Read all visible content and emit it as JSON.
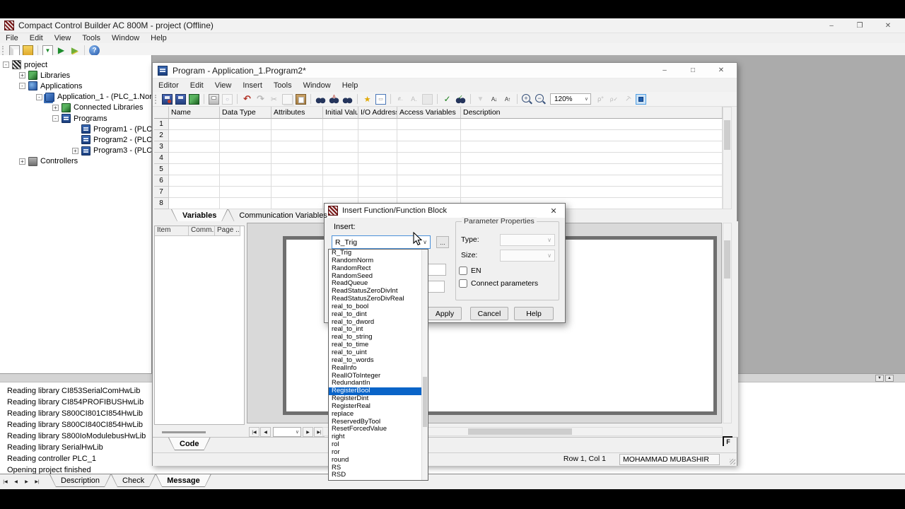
{
  "window": {
    "title": "Compact Control Builder AC 800M - project   (Offline)",
    "menu": [
      "File",
      "Edit",
      "View",
      "Tools",
      "Window",
      "Help"
    ],
    "toolbar": [
      {
        "name": "new-icon"
      },
      {
        "name": "open-icon"
      },
      {
        "sep": 1
      },
      {
        "name": "download-project-icon"
      },
      {
        "name": "go-online-icon"
      },
      {
        "name": "go-offline-icon"
      },
      {
        "sep": 1
      },
      {
        "name": "help-icon"
      }
    ],
    "controls": [
      "minimize",
      "restore",
      "close"
    ]
  },
  "tree": {
    "items": [
      {
        "label": "project",
        "depth": 0,
        "icon": "project-icon",
        "expander": "-"
      },
      {
        "label": "Libraries",
        "depth": 1,
        "icon": "libraries-icon",
        "expander": "+"
      },
      {
        "label": "Applications",
        "depth": 1,
        "icon": "applications-icon",
        "expander": "-"
      },
      {
        "label": "Application_1 - (PLC_1.Nor",
        "depth": 2,
        "icon": "application-icon",
        "expander": "-"
      },
      {
        "label": "Connected Libraries",
        "depth": 3,
        "icon": "libraries-icon",
        "expander": "+"
      },
      {
        "label": "Programs",
        "depth": 3,
        "icon": "programs-icon",
        "expander": "-"
      },
      {
        "label": "Program1 - (PLC",
        "depth": 4,
        "icon": "program-icon",
        "expander": ""
      },
      {
        "label": "Program2 - (PLC",
        "depth": 4,
        "icon": "program-icon",
        "expander": ""
      },
      {
        "label": "Program3 - (PLC",
        "depth": 4,
        "icon": "program-icon",
        "expander": "+"
      },
      {
        "label": "Controllers",
        "depth": 1,
        "icon": "controllers-icon",
        "expander": "+"
      }
    ]
  },
  "program": {
    "title": "Program - Application_1.Program2*",
    "menu": [
      "Editor",
      "Edit",
      "View",
      "Insert",
      "Tools",
      "Window",
      "Help"
    ],
    "toolbar": [
      {
        "name": "save-close-icon"
      },
      {
        "name": "save-icon"
      },
      {
        "name": "import-icon"
      },
      {
        "sep": 1
      },
      {
        "name": "print-icon"
      },
      {
        "name": "print-preview-icon",
        "dim": 1
      },
      {
        "sep": 1
      },
      {
        "name": "undo-icon"
      },
      {
        "name": "redo-icon",
        "dim": 1
      },
      {
        "name": "cut-icon",
        "dim": 1
      },
      {
        "name": "copy-icon",
        "dim": 1
      },
      {
        "name": "paste-icon"
      },
      {
        "sep": 1
      },
      {
        "name": "find-icon"
      },
      {
        "name": "find-replace-icon"
      },
      {
        "name": "binoculars-icon"
      },
      {
        "sep": 1
      },
      {
        "name": "wizard-icon"
      },
      {
        "name": "message-box-icon"
      },
      {
        "sep": 1
      },
      {
        "name": "if-then-icon",
        "dim": 1
      },
      {
        "name": "text-format-icon",
        "dim": 1
      },
      {
        "name": "insert-block-icon",
        "dim": 1
      },
      {
        "sep": 1
      },
      {
        "name": "check-icon"
      },
      {
        "name": "find-online-icon"
      },
      {
        "sep": 1
      },
      {
        "name": "filter-icon",
        "dim": 1
      },
      {
        "name": "sort-asc-icon"
      },
      {
        "name": "sort-desc-icon"
      },
      {
        "sep": 1
      },
      {
        "name": "zoom-in-icon"
      },
      {
        "name": "zoom-out-icon"
      },
      {
        "combo": "zoom"
      },
      {
        "name": "declare-icon",
        "dim": 1
      },
      {
        "name": "declare2-icon",
        "dim": 1
      },
      {
        "name": "wrench-icon",
        "dim": 1
      },
      {
        "name": "connections-icon",
        "active": 1
      }
    ],
    "zoom_value": "120%",
    "grid_headers": [
      "Name",
      "Data Type",
      "Attributes",
      "Initial Value",
      "I/O Address",
      "Access Variables",
      "Description"
    ],
    "rows": [
      "1",
      "2",
      "3",
      "4",
      "5",
      "6",
      "7",
      "8"
    ],
    "tabs": [
      {
        "label": "Variables",
        "active": true
      },
      {
        "label": "Communication Variables",
        "active": false
      }
    ],
    "list_columns": [
      "Item",
      "Comm...",
      "Page ..."
    ],
    "code_tab": "Code",
    "status_position": "Row 1, Col 1",
    "status_user": "MOHAMMAD MUBASHIR",
    "controls": [
      "minimize",
      "maximize",
      "close"
    ]
  },
  "dialog": {
    "title": "Insert Function/Function Block",
    "insert_label": "Insert:",
    "insert_value": "R_Trig",
    "more_button": "...",
    "group_title": "Parameter Properties",
    "type_label": "Type:",
    "size_label": "Size:",
    "en_label": "EN",
    "connect_label": "Connect parameters",
    "apply_button": "Apply",
    "cancel_button": "Cancel",
    "help_button": "Help",
    "selected_item": "RegisterBool",
    "items": [
      "R_Trig",
      "RandomNorm",
      "RandomRect",
      "RandomSeed",
      "ReadQueue",
      "ReadStatusZeroDivInt",
      "ReadStatusZeroDivReal",
      "real_to_bool",
      "real_to_dint",
      "real_to_dword",
      "real_to_int",
      "real_to_string",
      "real_to_time",
      "real_to_uint",
      "real_to_words",
      "RealInfo",
      "RealIOToInteger",
      "RedundantIn",
      "RegisterBool",
      "RegisterDint",
      "RegisterReal",
      "replace",
      "ReservedByTool",
      "ResetForcedValue",
      "right",
      "rol",
      "ror",
      "round",
      "RS",
      "RSD"
    ]
  },
  "messages": [
    "Reading library CI853SerialComHwLib",
    "Reading library CI854PROFIBUSHwLib",
    "Reading library S800CI801CI854HwLib",
    "Reading library S800CI840CI854HwLib",
    "Reading library S800IoModulebusHwLib",
    "Reading library SerialHwLib",
    "Reading controller PLC_1",
    "Opening project finished"
  ],
  "bottom": {
    "tabs": [
      {
        "label": "Description",
        "active": false
      },
      {
        "label": "Check",
        "active": false
      },
      {
        "label": "Message",
        "active": true
      }
    ]
  },
  "colors": {
    "selection": "#0a64c8",
    "workspace": "#ababab"
  }
}
